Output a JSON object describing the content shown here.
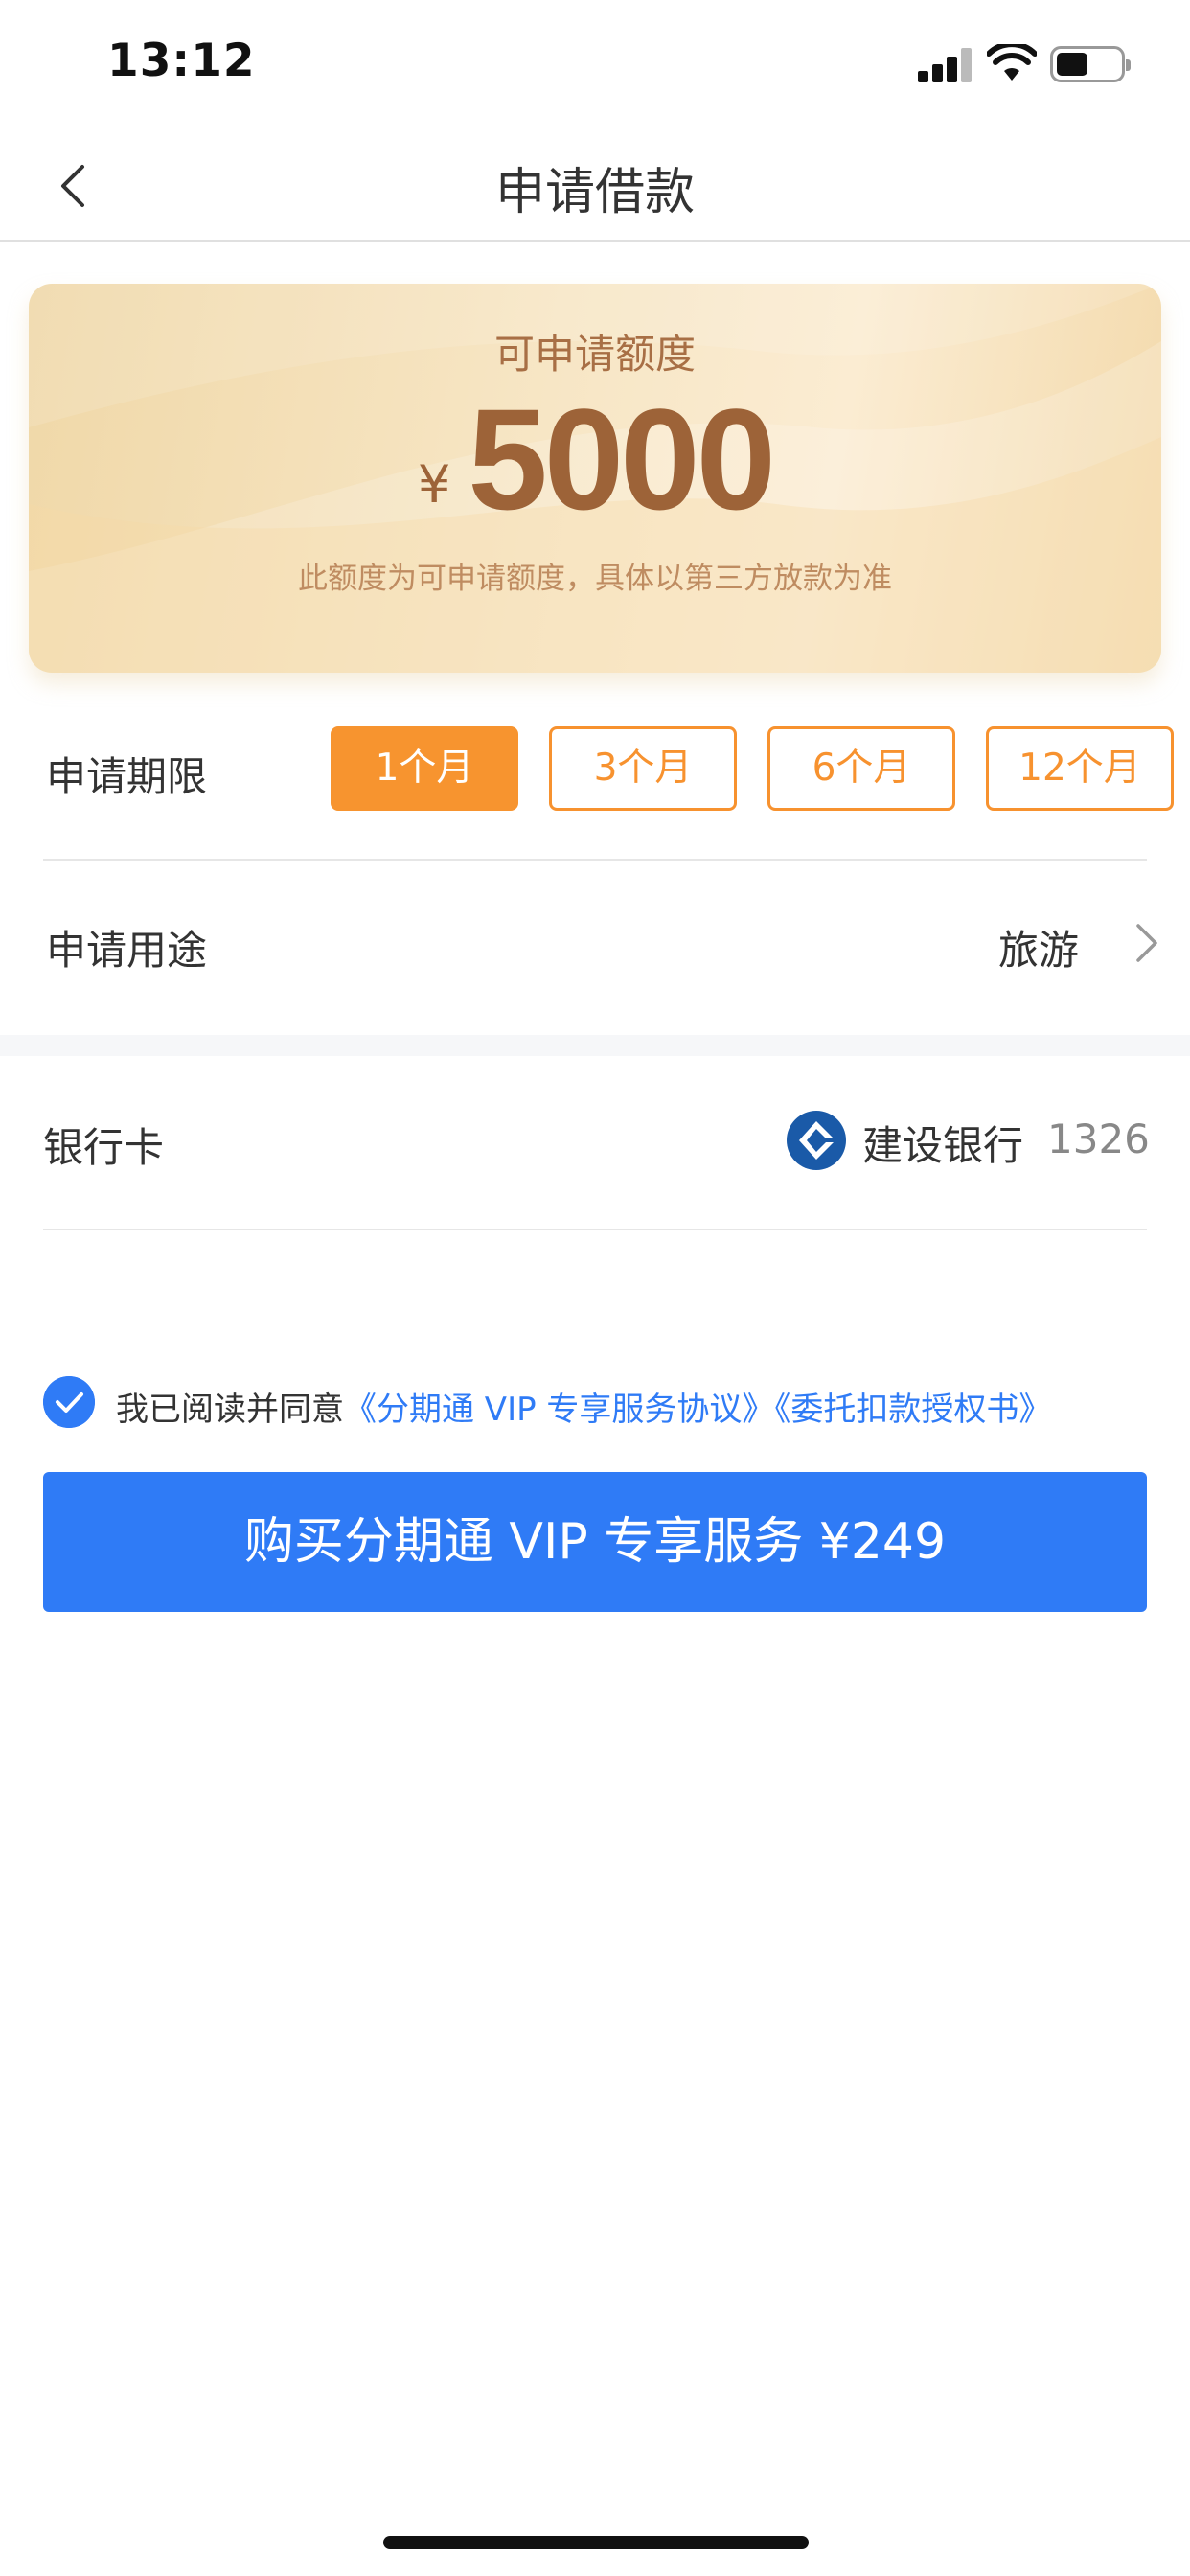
{
  "status_bar": {
    "time": "13:12",
    "battery_level": 0.5
  },
  "nav": {
    "title": "申请借款",
    "back_icon": "chevron-left-icon"
  },
  "quota_card": {
    "label": "可申请额度",
    "currency": "¥",
    "amount": "5000",
    "note": "此额度为可申请额度，具体以第三方放款为准"
  },
  "term": {
    "label": "申请期限",
    "options": [
      "1个月",
      "3个月",
      "6个月",
      "12个月"
    ],
    "selected": "1个月",
    "accent": "#f7942f"
  },
  "purpose": {
    "label": "申请用途",
    "value": "旅游",
    "icon": "chevron-right-icon"
  },
  "bank_card": {
    "label": "银行卡",
    "bank_name": "建设银行",
    "card_tail": "1326",
    "logo_color": "#1a5aa8"
  },
  "agreement": {
    "checked": true,
    "prefix": "我已阅读并同意",
    "links": [
      "《分期通 VIP 专享服务协议》",
      "《委托扣款授权书》"
    ],
    "link_color": "#2f7bf6"
  },
  "buy_button": {
    "label": "购买分期通 VIP 专享服务 ¥249",
    "color": "#2f7bf6"
  }
}
